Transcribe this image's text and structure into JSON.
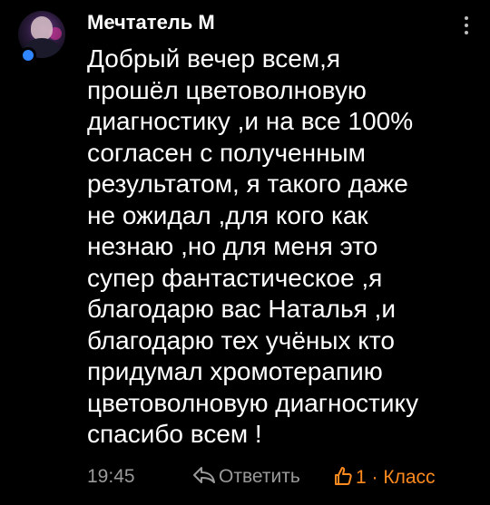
{
  "comment": {
    "author": "Мечтатель М",
    "text": "Добрый вечер всем,я\nпрошёл цветоволновую\nдиагностику ,и на все 100%\nсогласен с полученным\nрезультатом, я такого даже\nне ожидал ,для кого как\nнезнаю ,но для меня это\nсупер фантастическое ,я\nблагодарю вас Наталья ,и\nблагодарю тех учёных кто\nпридумал хромотерапию\nцветоволновую диагностику\nспасибо всем !",
    "time": "19:45",
    "reply_label": "Ответить",
    "like_count": "1",
    "like_separator": "·",
    "like_label": "Класс"
  },
  "icons": {
    "menu": "more-vertical-icon",
    "reply": "reply-arrow-icon",
    "like": "thumbs-up-icon"
  },
  "colors": {
    "background": "#000000",
    "text": "#ffffff",
    "muted": "#9a9a9a",
    "accent": "#ff8a1e",
    "online": "#2f86ff"
  }
}
